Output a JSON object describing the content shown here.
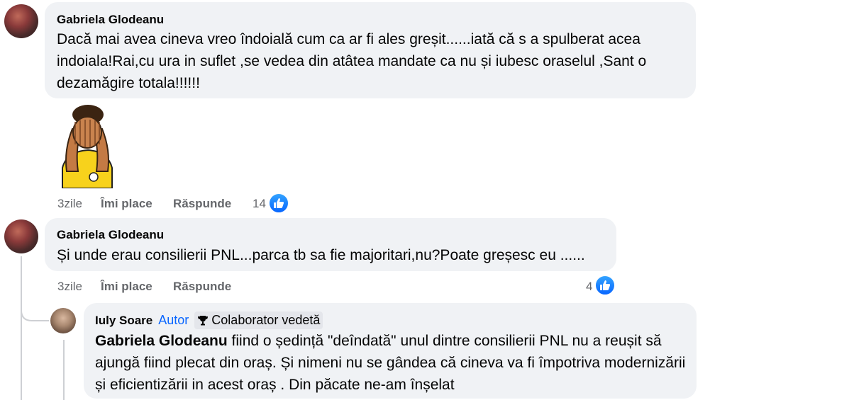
{
  "comment1": {
    "author": "Gabriela Glodeanu",
    "text": "Dacă mai avea cineva vreo îndoială cum ca ar fi ales greșit......iată că s a spulberat acea indoiala!Rai,cu ura in suflet ,se vedea din atâtea mandate ca nu și iubesc oraselul ,Sant o dezamăgire totala!!!!!!",
    "sticker": "face-palm-sticker",
    "time": "3zile",
    "like_label": "Îmi place",
    "reply_label": "Răspunde",
    "reaction_count": "14"
  },
  "comment2": {
    "author": "Gabriela Glodeanu",
    "text": "Și unde erau consilierii PNL...parca tb sa fie majoritari,nu?Poate greșesc eu ......",
    "time": "3zile",
    "like_label": "Îmi place",
    "reply_label": "Răspunde",
    "reaction_count": "4"
  },
  "reply": {
    "author": "Iuly Soare",
    "author_tag": "Autor",
    "badge": "Colaborator vedetă",
    "mention": "Gabriela Glodeanu",
    "text": " fiind o ședință \"deîndată\" unul dintre consilierii PNL nu a reușit să ajungă fiind plecat din oraș. Și nimeni nu se gândea că cineva va fi împotriva modernizării și eficientizării in acest oraș . Din păcate ne-am înșelat"
  },
  "colors": {
    "bubble": "#f0f2f5",
    "meta": "#65676b",
    "like_blue": "#0866ff"
  }
}
